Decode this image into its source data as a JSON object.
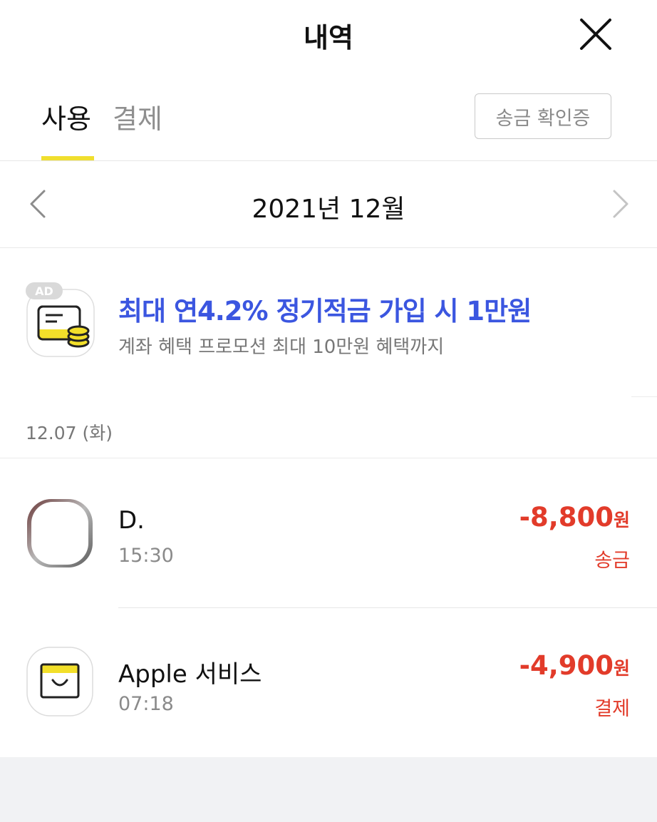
{
  "header": {
    "title": "내역",
    "close_icon": "close-icon"
  },
  "tabs": {
    "items": [
      {
        "label": "사용",
        "active": true
      },
      {
        "label": "결제",
        "active": false
      }
    ],
    "receipt_button": "송금 확인증",
    "indicator_color": "#f0df2e"
  },
  "month_nav": {
    "label": "2021년 12월",
    "prev_icon": "chevron-left-icon",
    "next_icon": "chevron-right-icon"
  },
  "ad": {
    "badge": "AD",
    "title": "최대 연4.2% 정기적금 가입 시 1만원",
    "subtitle": "계좌 혜택 프로모션 최대 10만원 혜택까지",
    "icon": "savings-card-coins-icon",
    "title_color": "#3b56e0"
  },
  "date_group": {
    "label": "12.07 (화)"
  },
  "transactions": [
    {
      "name": "D.",
      "time": "15:30",
      "amount": "-8,800",
      "unit": "원",
      "type": "송금",
      "icon": "avatar-icon"
    },
    {
      "name": "Apple 서비스",
      "time": "07:18",
      "amount": "-4,900",
      "unit": "원",
      "type": "결제",
      "icon": "shopping-bag-icon"
    }
  ],
  "colors": {
    "negative_amount": "#e23b2a",
    "accent_yellow": "#f0df2e",
    "muted_text": "#8a8a8a"
  }
}
